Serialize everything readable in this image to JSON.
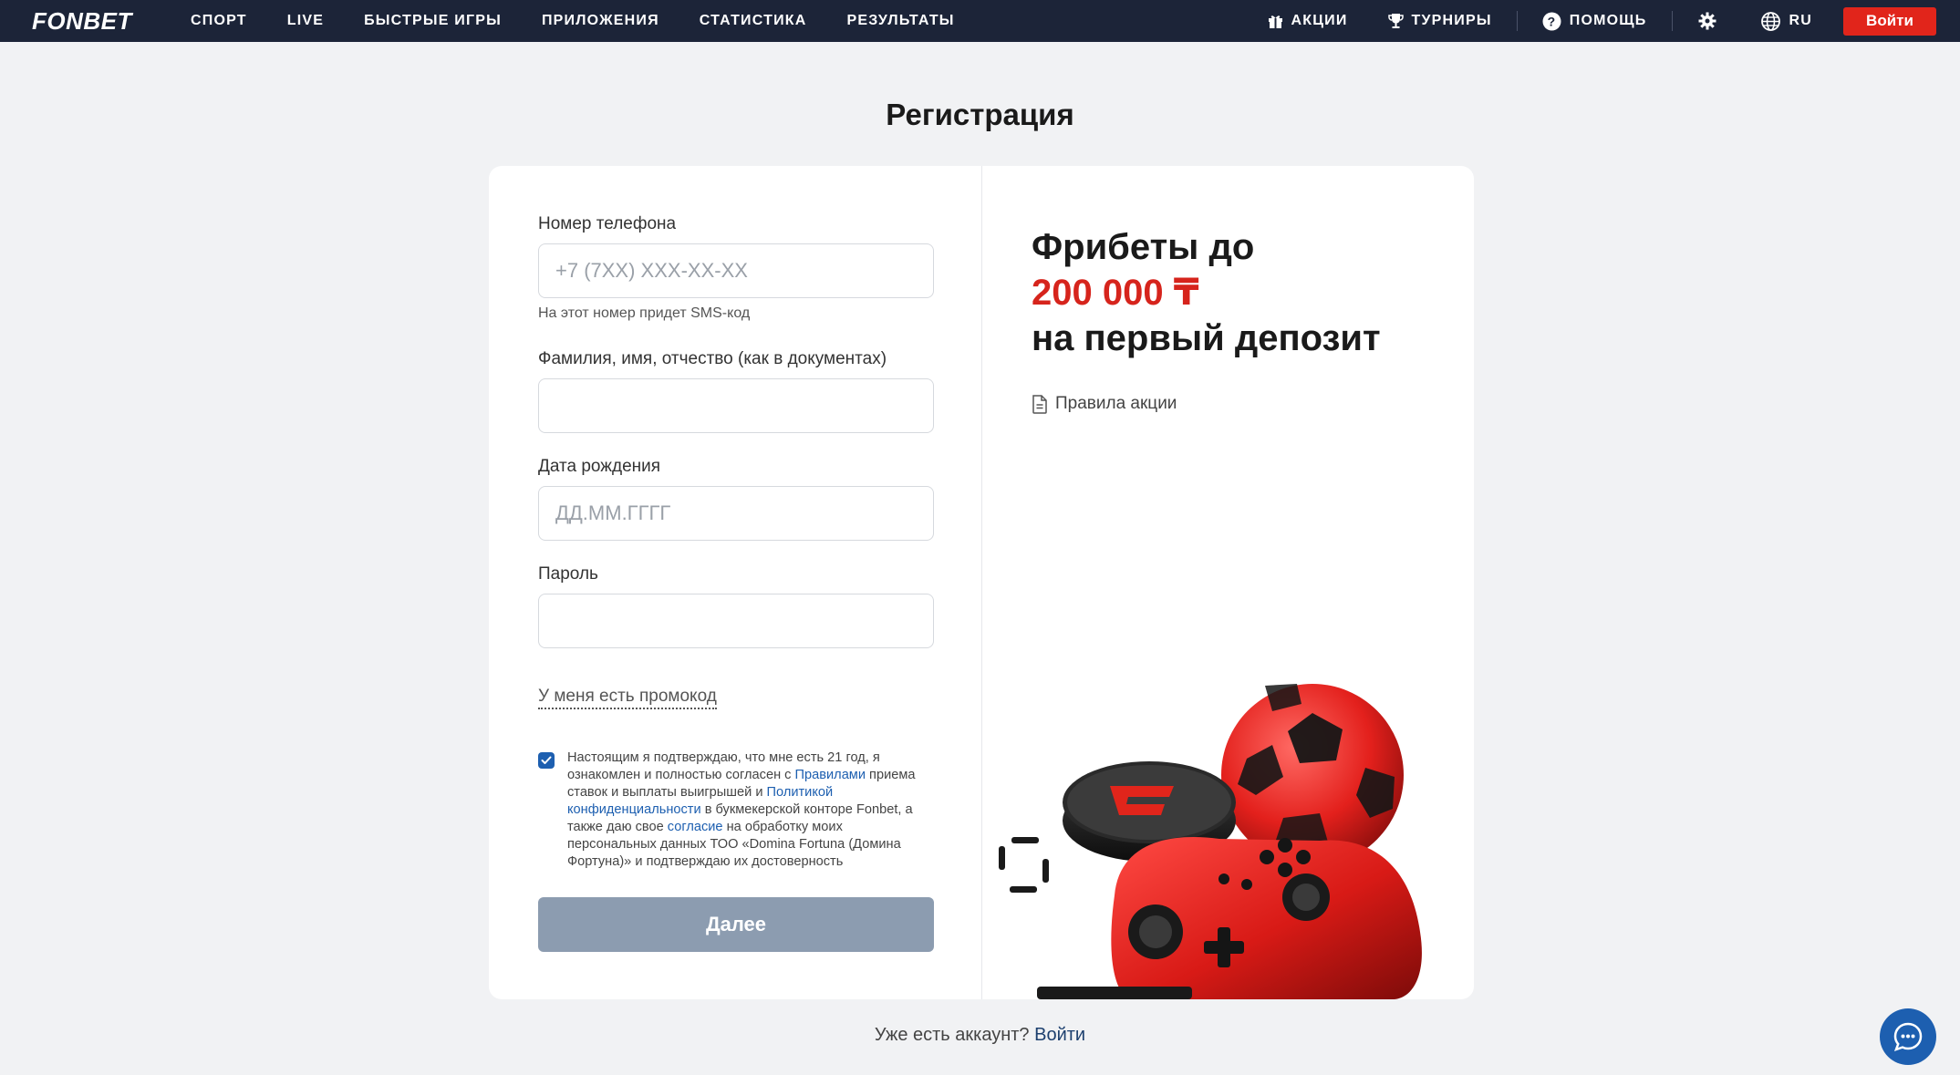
{
  "header": {
    "logo": "FONBET",
    "nav": [
      "СПОРТ",
      "LIVE",
      "БЫСТРЫЕ ИГРЫ",
      "ПРИЛОЖЕНИЯ",
      "СТАТИСТИКА",
      "РЕЗУЛЬТАТЫ"
    ],
    "promotions": "АКЦИИ",
    "tournaments": "ТУРНИРЫ",
    "help": "ПОМОЩЬ",
    "language": "RU",
    "login": "Войти"
  },
  "page": {
    "title": "Регистрация"
  },
  "form": {
    "phone_label": "Номер телефона",
    "phone_placeholder": "+7 (7XX) XXX-XX-XX",
    "phone_hint": "На этот номер придет SMS-код",
    "name_label": "Фамилия, имя, отчество (как в документах)",
    "name_value": "",
    "dob_label": "Дата рождения",
    "dob_placeholder": "ДД.ММ.ГГГГ",
    "password_label": "Пароль",
    "password_value": "",
    "promo_link": "У меня есть промокод",
    "consent_checked": true,
    "consent": {
      "part1": "Настоящим я подтверждаю, что мне есть 21 год, я ознакомлен и полностью согласен с ",
      "link1": "Правилами",
      "part2": " приема ставок и выплаты выигрышей и ",
      "link2": "Политикой конфиденциальности",
      "part3": " в букмекерской конторе Fonbet, а также даю свое ",
      "link3": "согласие",
      "part4": " на обработку моих персональных данных ТОО «Domina Fortuna (Домина Фортуна)» и подтверждаю их достоверность"
    },
    "submit": "Далее"
  },
  "promo": {
    "line1": "Фрибеты до",
    "amount": "200 000 ₸",
    "line3": "на первый депозит",
    "rules_link": "Правила акции"
  },
  "footer": {
    "question": "Уже есть аккаунт?",
    "login_link": "Войти"
  },
  "colors": {
    "header_bg": "#1c2438",
    "accent_red": "#e1251b",
    "link_blue": "#1d5fb0",
    "button_disabled": "#8c9cb0"
  }
}
